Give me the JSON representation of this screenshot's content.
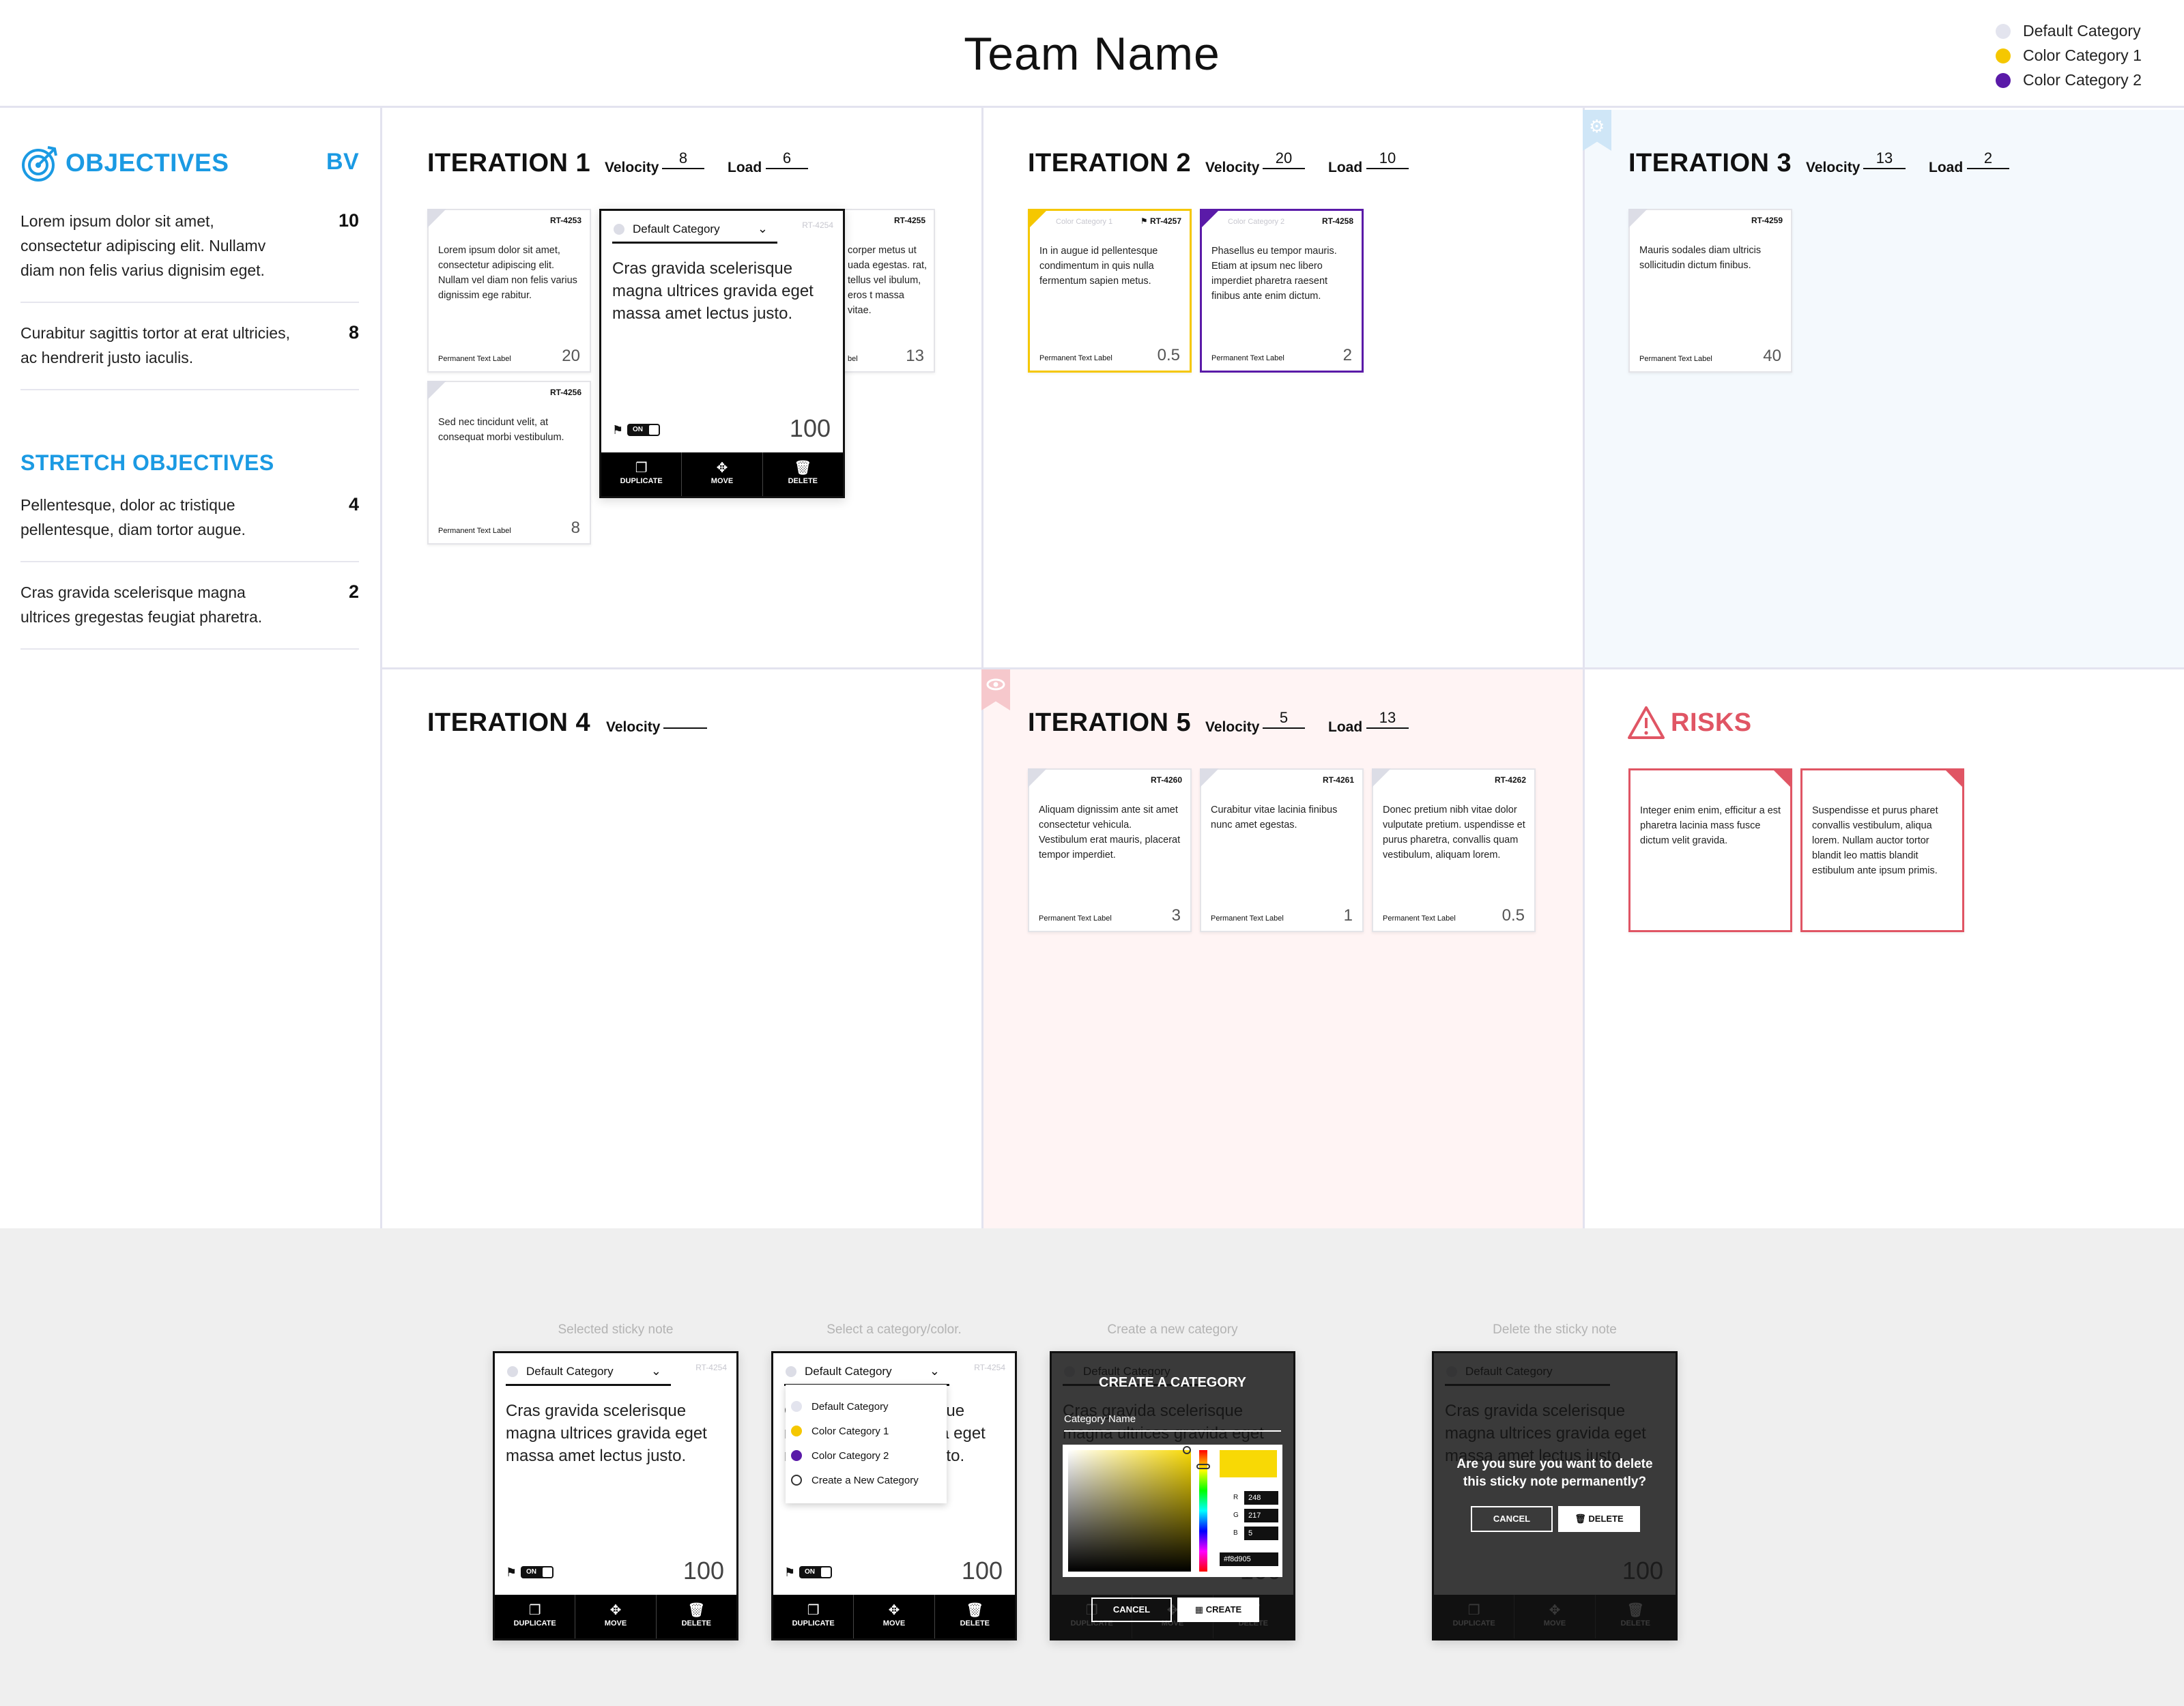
{
  "header": {
    "team_name": "Team Name"
  },
  "legend": [
    {
      "label": "Default Category",
      "color": "#e3e4ee"
    },
    {
      "label": "Color Category 1",
      "color": "#f5c700"
    },
    {
      "label": "Color Category 2",
      "color": "#5a1aa8"
    }
  ],
  "objectives": {
    "title": "OBJECTIVES",
    "bv_label": "BV",
    "items": [
      {
        "text": "Lorem ipsum dolor sit amet, consectetur adipiscing elit. Nullamv diam non felis varius dignisim eget.",
        "bv": "10"
      },
      {
        "text": "Curabitur sagittis tortor at erat ultricies, ac hendrerit justo iaculis.",
        "bv": "8"
      }
    ],
    "stretch_title": "STRETCH OBJECTIVES",
    "stretch_items": [
      {
        "text": "Pellentesque, dolor ac tristique pellentesque, diam tortor augue.",
        "bv": "4"
      },
      {
        "text": "Cras gravida scelerisque magna ultrices gregestas feugiat pharetra.",
        "bv": "2"
      }
    ]
  },
  "iterations": [
    {
      "title": "ITERATION 1",
      "velocity_label": "Velocity",
      "velocity": "8",
      "load_label": "Load",
      "load": "6",
      "cards": [
        {
          "id": "RT-4253",
          "text": "Lorem ipsum dolor sit amet, consectetur adipiscing elit. Nullam vel diam non felis varius dignissim ege rabitur.",
          "label": "Permanent Text Label",
          "points": "20"
        },
        {
          "id": "RT-4255",
          "text": "corper metus ut uada egestas. rat, tellus vel ibulum, eros t massa vitae.",
          "label": "bel",
          "points": "13"
        },
        {
          "id": "RT-4256",
          "text": "Sed nec tincidunt velit, at consequat morbi vestibulum.",
          "label": "Permanent Text Label",
          "points": "8"
        }
      ],
      "expanded": {
        "category": "Default Category",
        "id": "RT-4254",
        "text": "Cras gravida scelerisque magna ultrices gravida eget massa amet lectus justo.",
        "toggle": "ON",
        "points": "100",
        "actions": [
          "DUPLICATE",
          "MOVE",
          "DELETE"
        ]
      }
    },
    {
      "title": "ITERATION 2",
      "velocity_label": "Velocity",
      "velocity": "20",
      "load_label": "Load",
      "load": "10",
      "cards": [
        {
          "id": "RT-4257",
          "category": "Color Category 1",
          "text": "In in augue id pellentesque condimentum in quis nulla fermentum sapien metus.",
          "label": "Permanent Text Label",
          "points": "0.5"
        },
        {
          "id": "RT-4258",
          "category": "Color Category 2",
          "text": "Phasellus eu tempor mauris. Etiam at ipsum nec libero imperdiet pharetra raesent finibus ante enim dictum.",
          "label": "Permanent Text Label",
          "points": "2"
        }
      ]
    },
    {
      "title": "ITERATION 3",
      "velocity_label": "Velocity",
      "velocity": "13",
      "load_label": "Load",
      "load": "2",
      "cards": [
        {
          "id": "RT-4259",
          "text": "Mauris sodales diam ultricis sollicitudin dictum finibus.",
          "label": "Permanent Text Label",
          "points": "40"
        }
      ]
    },
    {
      "title": "ITERATION 4",
      "velocity_label": "Velocity",
      "velocity": ""
    },
    {
      "title": "ITERATION 5",
      "velocity_label": "Velocity",
      "velocity": "5",
      "load_label": "Load",
      "load": "13",
      "cards": [
        {
          "id": "RT-4260",
          "text": "Aliquam dignissim ante sit amet consectetur vehicula. Vestibulum erat mauris, placerat tempor imperdiet.",
          "label": "Permanent Text Label",
          "points": "3"
        },
        {
          "id": "RT-4261",
          "text": "Curabitur vitae lacinia finibus nunc amet egestas.",
          "label": "Permanent Text Label",
          "points": "1"
        },
        {
          "id": "RT-4262",
          "text": "Donec pretium nibh vitae dolor vulputate pretium. uspendisse et purus pharetra, convallis quam vestibulum, aliquam lorem.",
          "label": "Permanent Text Label",
          "points": "0.5"
        }
      ]
    }
  ],
  "risks": {
    "title": "RISKS",
    "cards": [
      {
        "text": "Integer enim enim, efficitur a est pharetra lacinia mass fusce dictum velit gravida."
      },
      {
        "text": "Suspendisse et purus pharet convallis vestibulum, aliqua lorem. Nullam auctor tortor blandit leo mattis blandit estibulum ante ipsum primis."
      }
    ]
  },
  "states": {
    "captions": [
      "Selected sticky note",
      "Select a category/color.",
      "Create a new category",
      "Delete the sticky note"
    ],
    "card": {
      "category": "Default Category",
      "id": "RT-4254",
      "text": "Cras gravida scelerisque magna ultrices gravida eget massa amet lectus justo.",
      "toggle": "ON",
      "points": "100",
      "actions": [
        "DUPLICATE",
        "MOVE",
        "DELETE"
      ]
    },
    "dropdown": [
      "Default Category",
      "Color Category 1",
      "Color Category 2",
      "Create a New Category"
    ],
    "create": {
      "title": "CREATE A CATEGORY",
      "field_label": "Category Name",
      "r_label": "R",
      "g_label": "G",
      "b_label": "B",
      "r": "248",
      "g": "217",
      "b": "5",
      "hex": "#f8d905",
      "cancel": "CANCEL",
      "create": "CREATE",
      "swatch_color": "#f8d905"
    },
    "delete": {
      "question": "Are you sure you want to delete this sticky note permanently?",
      "cancel": "CANCEL",
      "delete": "DELETE"
    }
  }
}
